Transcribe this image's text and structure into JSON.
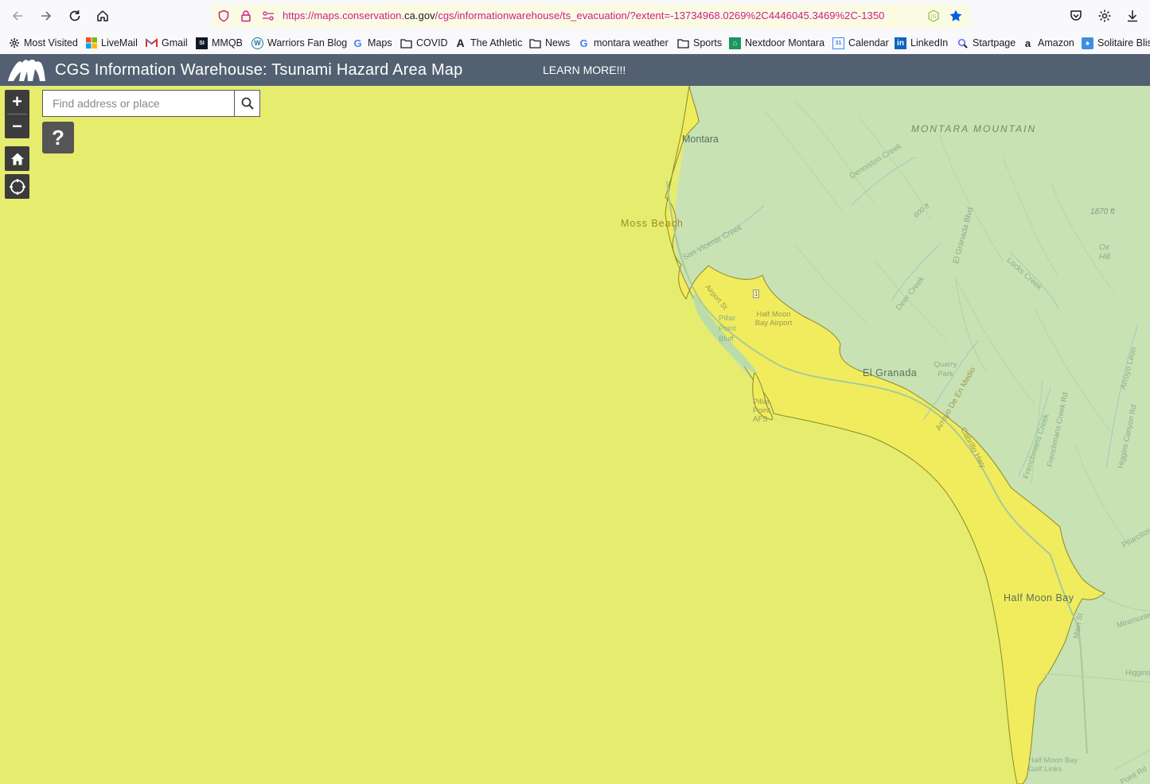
{
  "browser": {
    "url_prefix": "https://maps.conservation.",
    "url_domain": "ca.gov",
    "url_rest": "/cgs/informationwarehouse/ts_evacuation/?extent=-13734968.0269%2C4446045.3469%2C-1350"
  },
  "bookmarks": [
    {
      "label": "Most Visited",
      "icon": "gear-icon"
    },
    {
      "label": "LiveMail",
      "icon": "windows-logo-icon"
    },
    {
      "label": "Gmail",
      "icon": "gmail-icon"
    },
    {
      "label": "MMQB",
      "icon": "mmqb-icon"
    },
    {
      "label": "Warriors Fan Blog",
      "icon": "wordpress-icon"
    },
    {
      "label": "Maps",
      "icon": "google-icon"
    },
    {
      "label": "COVID",
      "icon": "folder-icon"
    },
    {
      "label": "The Athletic",
      "icon": "athletic-icon"
    },
    {
      "label": "News",
      "icon": "folder-icon"
    },
    {
      "label": "montara weather",
      "icon": "google-icon"
    },
    {
      "label": "Sports",
      "icon": "folder-icon"
    },
    {
      "label": "Nextdoor Montara",
      "icon": "nextdoor-icon"
    },
    {
      "label": "Calendar",
      "icon": "calendar-icon"
    },
    {
      "label": "LinkedIn",
      "icon": "linkedin-icon"
    },
    {
      "label": "Startpage",
      "icon": "startpage-icon"
    },
    {
      "label": "Amazon",
      "icon": "amazon-icon"
    },
    {
      "label": "Solitaire Bliss",
      "icon": "solitaire-icon"
    }
  ],
  "app": {
    "title": "CGS Information Warehouse: Tsunami Hazard Area Map",
    "learn_more": "LEARN MORE!!!"
  },
  "map_controls": {
    "zoom_in": "+",
    "zoom_out": "−",
    "search_placeholder": "Find address or place",
    "help": "?"
  },
  "map_labels": {
    "montara_mountain": "MONTARA MOUNTAIN",
    "montara": "Montara",
    "moss_beach": "Moss Beach",
    "denniston_creek": "Denniston Creek",
    "elev_1870": "1870 ft",
    "elev_600": "600 ft",
    "el_granada_blvd": "El Granada Blvd",
    "ox_hill": "Ox Hill",
    "san_vicente_creek": "San Vicente Creek",
    "locks_creek": "Locks Creek",
    "deer_creek": "Deer Creek",
    "airport_st": "Airport St",
    "route1": "1",
    "half_moon_bay_airport": "Half Moon Bay Airport",
    "pillar_point_bluff": "Pillar Point Bluff",
    "el_granada": "El Granada",
    "quarry_park": "Quarry Park",
    "arroyo_de_en_medio": "Arroyo De En Medio",
    "cabrillo_hwy": "Cabrillo Hwy",
    "pillar_point_afs": "Pillar Point AFS",
    "frenchmans_creek": "Frenchmans Creek",
    "frenchmans_creek_rd": "Frenchmans Creek Rd",
    "higgins_canyon_rd": "Higgins Canyon Rd",
    "arroyo_leon": "Arroyo Leon",
    "pilarcitos": "Pilarcitos",
    "half_moon_bay": "Half Moon Bay",
    "main_st": "Main St",
    "miramontes": "Miramontes",
    "higgins": "Higgins",
    "half_moon_bay_golf": "Half Moon Bay Golf Links",
    "point_rd": "Point Rd"
  },
  "colors": {
    "ocean": "#e6ec6e",
    "land": "#c9e2b4",
    "hazard_zone": "#f0ec5e",
    "header": "#536072"
  }
}
